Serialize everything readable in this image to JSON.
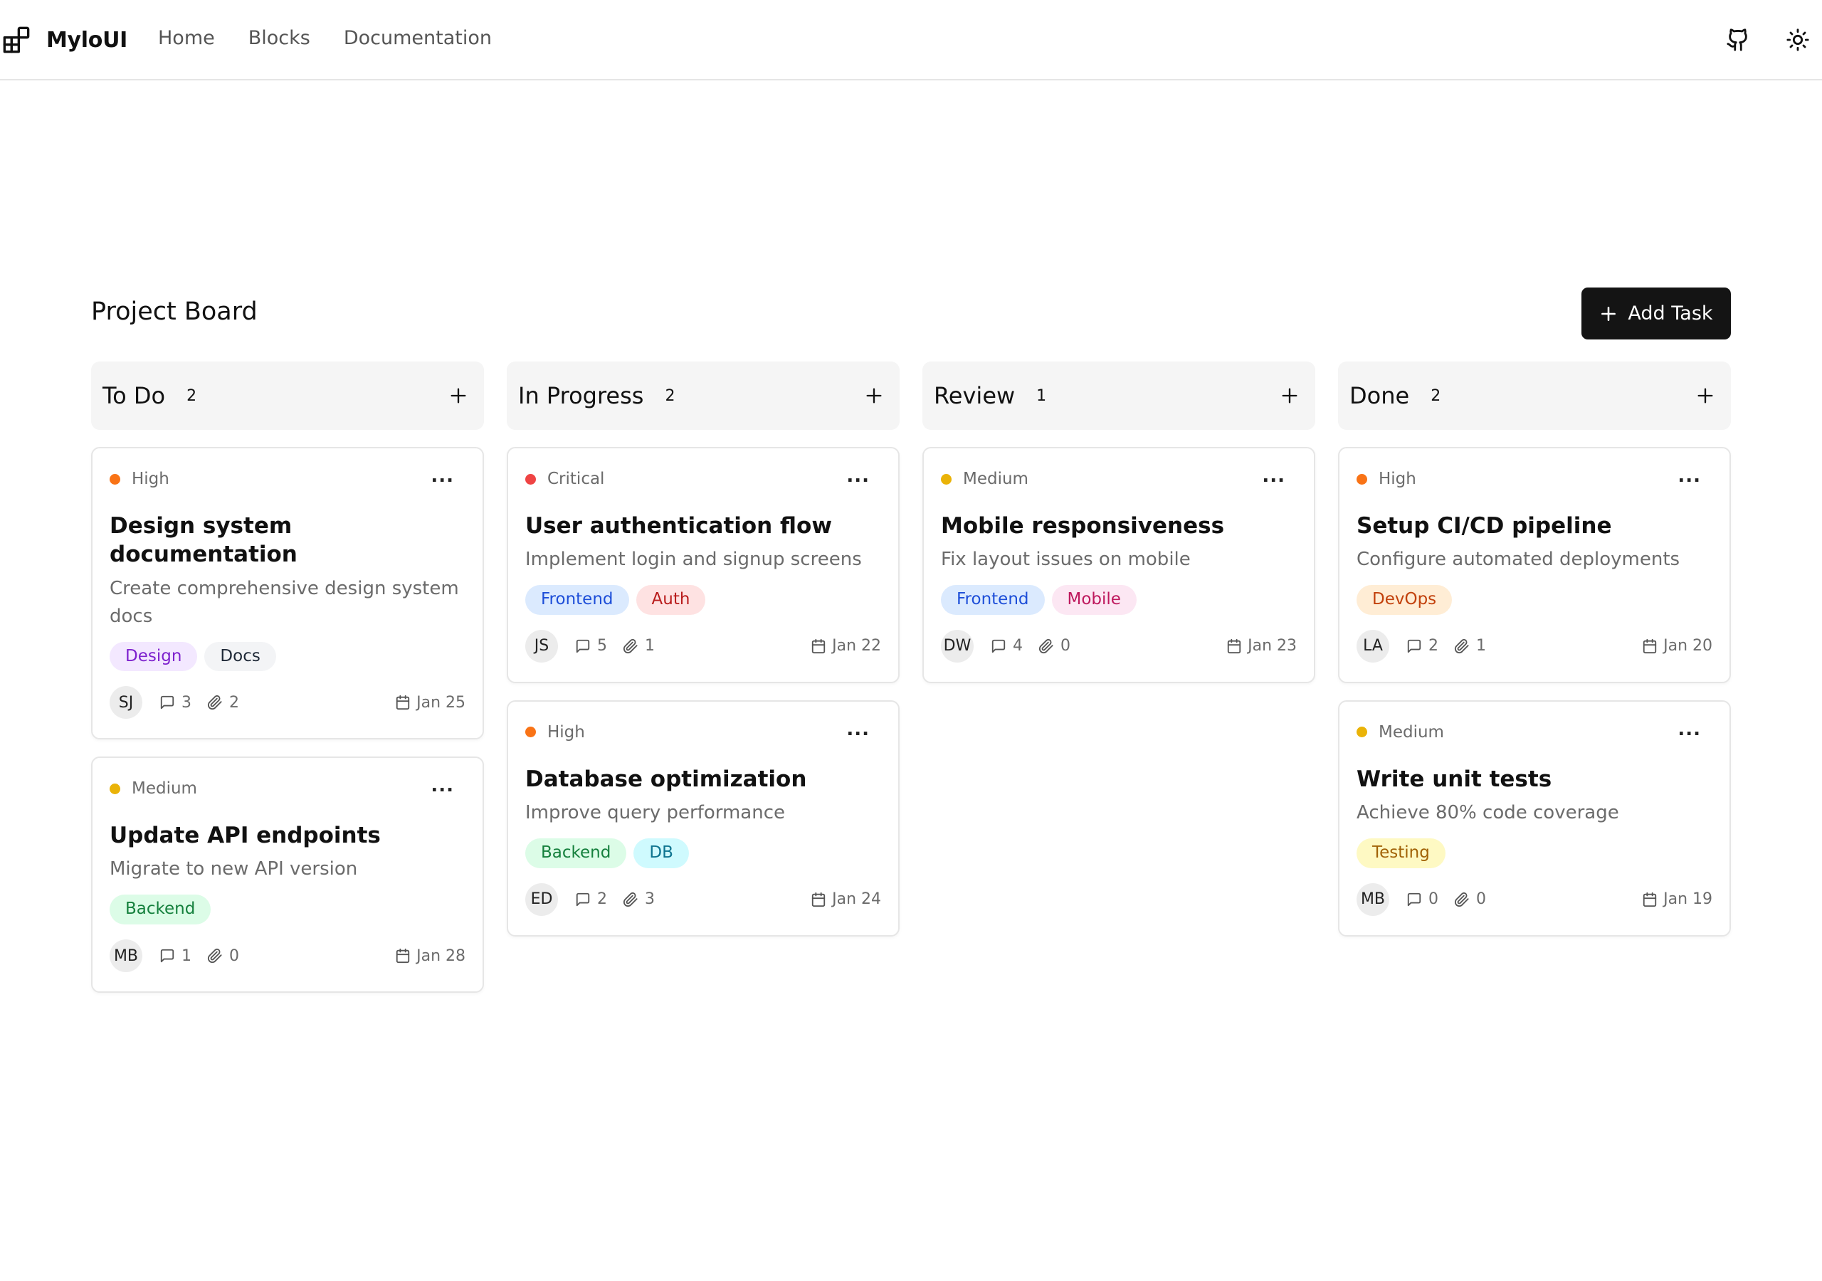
{
  "nav": {
    "brand": "MyloUI",
    "links": [
      "Home",
      "Blocks",
      "Documentation"
    ]
  },
  "board": {
    "title": "Project Board",
    "add_task_label": "Add Task",
    "columns": [
      {
        "title": "To Do",
        "count": "2",
        "cards": [
          {
            "priority": "High",
            "priority_color": "#f97316",
            "title": "Design system documentation",
            "description": "Create comprehensive design system docs",
            "tags": [
              {
                "label": "Design",
                "bg": "#f3e8ff",
                "fg": "#7e22ce"
              },
              {
                "label": "Docs",
                "bg": "#f3f4f6",
                "fg": "#1f2937"
              }
            ],
            "assignee": "SJ",
            "comments": "3",
            "attachments": "2",
            "due": "Jan 25"
          },
          {
            "priority": "Medium",
            "priority_color": "#eab308",
            "title": "Update API endpoints",
            "description": "Migrate to new API version",
            "tags": [
              {
                "label": "Backend",
                "bg": "#dcfce7",
                "fg": "#15803d"
              }
            ],
            "assignee": "MB",
            "comments": "1",
            "attachments": "0",
            "due": "Jan 28"
          }
        ]
      },
      {
        "title": "In Progress",
        "count": "2",
        "cards": [
          {
            "priority": "Critical",
            "priority_color": "#ef4444",
            "title": "User authentication flow",
            "description": "Implement login and signup screens",
            "tags": [
              {
                "label": "Frontend",
                "bg": "#dbeafe",
                "fg": "#1d4ed8"
              },
              {
                "label": "Auth",
                "bg": "#fee2e2",
                "fg": "#b91c1c"
              }
            ],
            "assignee": "JS",
            "comments": "5",
            "attachments": "1",
            "due": "Jan 22"
          },
          {
            "priority": "High",
            "priority_color": "#f97316",
            "title": "Database optimization",
            "description": "Improve query performance",
            "tags": [
              {
                "label": "Backend",
                "bg": "#dcfce7",
                "fg": "#15803d"
              },
              {
                "label": "DB",
                "bg": "#cffafe",
                "fg": "#0e7490"
              }
            ],
            "assignee": "ED",
            "comments": "2",
            "attachments": "3",
            "due": "Jan 24"
          }
        ]
      },
      {
        "title": "Review",
        "count": "1",
        "cards": [
          {
            "priority": "Medium",
            "priority_color": "#eab308",
            "title": "Mobile responsiveness",
            "description": "Fix layout issues on mobile",
            "tags": [
              {
                "label": "Frontend",
                "bg": "#dbeafe",
                "fg": "#1d4ed8"
              },
              {
                "label": "Mobile",
                "bg": "#fce7f3",
                "fg": "#be185d"
              }
            ],
            "assignee": "DW",
            "comments": "4",
            "attachments": "0",
            "due": "Jan 23"
          }
        ]
      },
      {
        "title": "Done",
        "count": "2",
        "cards": [
          {
            "priority": "High",
            "priority_color": "#f97316",
            "title": "Setup CI/CD pipeline",
            "description": "Configure automated deployments",
            "tags": [
              {
                "label": "DevOps",
                "bg": "#ffedd5",
                "fg": "#c2410c"
              }
            ],
            "assignee": "LA",
            "comments": "2",
            "attachments": "1",
            "due": "Jan 20"
          },
          {
            "priority": "Medium",
            "priority_color": "#eab308",
            "title": "Write unit tests",
            "description": "Achieve 80% code coverage",
            "tags": [
              {
                "label": "Testing",
                "bg": "#fef9c3",
                "fg": "#a16207"
              }
            ],
            "assignee": "MB",
            "comments": "0",
            "attachments": "0",
            "due": "Jan 19"
          }
        ]
      }
    ]
  },
  "icons": {
    "brand": "blocks-icon",
    "github": "github-icon",
    "theme": "sun-icon",
    "add": "plus-icon",
    "more": "more-horizontal-icon",
    "comments": "message-square-icon",
    "attachments": "paperclip-icon",
    "due": "calendar-icon"
  }
}
